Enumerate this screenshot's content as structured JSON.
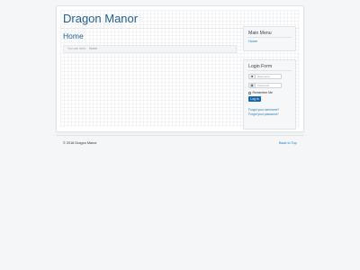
{
  "site": {
    "title": "Dragon Manor"
  },
  "main": {
    "page_title": "Home",
    "breadcrumb": {
      "prefix": "You are here:",
      "current": "Home"
    }
  },
  "menu": {
    "title": "Main Menu",
    "items": [
      {
        "label": "Home"
      }
    ]
  },
  "login": {
    "title": "Login Form",
    "username_placeholder": "Username",
    "password_placeholder": "Password",
    "remember_label": "Remember Me",
    "submit_label": "Log in",
    "forgot_username": "Forgot your username?",
    "forgot_password": "Forgot your password?"
  },
  "footer": {
    "copyright": "© 2018 Dragon Manor",
    "back_to_top": "Back to Top"
  },
  "colors": {
    "title": "#1f5f91",
    "link": "#1d7bc1",
    "button": "#1565b0"
  },
  "icons": {
    "user": "user-icon",
    "password": "lock-icon"
  }
}
